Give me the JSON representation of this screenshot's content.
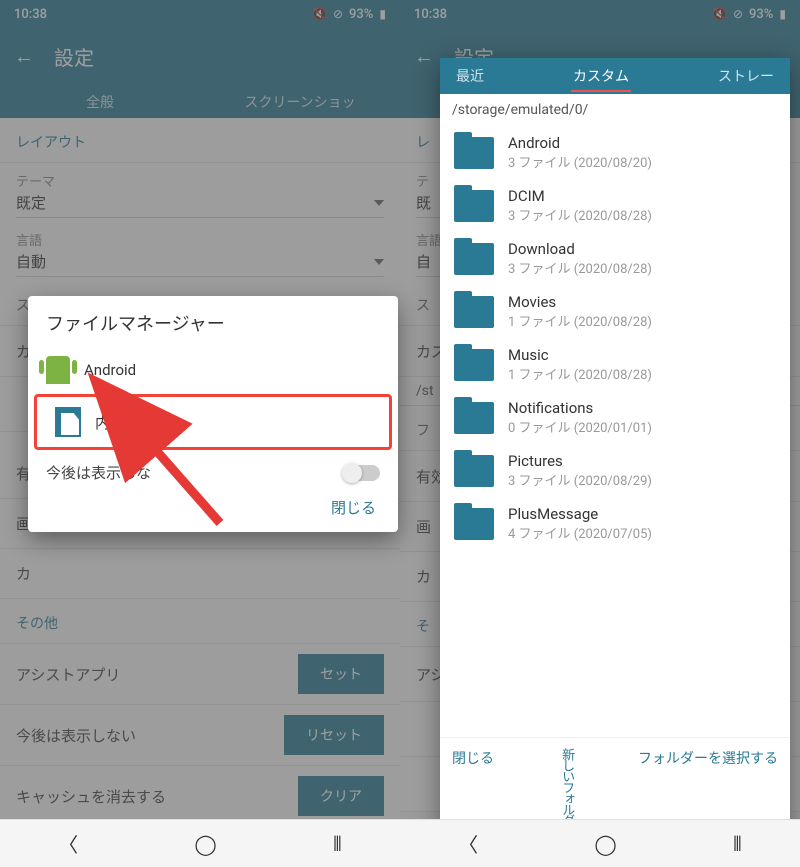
{
  "status": {
    "time": "10:38",
    "battery": "93%"
  },
  "left": {
    "title": "設定",
    "tabs": [
      "全般",
      "スクリーンショッ"
    ],
    "sections": {
      "layout": "レイアウト",
      "theme_label": "テーマ",
      "theme_value": "既定",
      "lang_label": "言語",
      "lang_value": "自動",
      "other": "その他"
    },
    "rows": {
      "assist": "アシストアプリ",
      "assist_btn": "セット",
      "dont_show": "今後は表示しない",
      "dont_show_btn": "リセット",
      "cache": "キャッシュを消去する",
      "cache_btn": "クリア",
      "enabled": "有"
    },
    "dialog": {
      "title": "ファイルマネージャー",
      "item_android": "Android",
      "item_internal": "内部",
      "dont_show": "今後は表示しな",
      "close": "閉じる"
    }
  },
  "right": {
    "title": "設定",
    "tabs": {
      "recent": "最近",
      "custom": "カスタム",
      "store": "ストレー"
    },
    "path": "/storage/emulated/0/",
    "folders": [
      {
        "name": "Android",
        "sub": "3 ファイル (2020/08/20)"
      },
      {
        "name": "DCIM",
        "sub": "3 ファイル (2020/08/28)"
      },
      {
        "name": "Download",
        "sub": "3 ファイル (2020/08/28)"
      },
      {
        "name": "Movies",
        "sub": "1 ファイル (2020/08/28)"
      },
      {
        "name": "Music",
        "sub": "1 ファイル (2020/08/28)"
      },
      {
        "name": "Notifications",
        "sub": "0 ファイル (2020/01/01)"
      },
      {
        "name": "Pictures",
        "sub": "3 ファイル (2020/08/29)"
      },
      {
        "name": "PlusMessage",
        "sub": "4 ファイル (2020/07/05)"
      }
    ],
    "actions": {
      "close": "閉じる",
      "newfolder": "新しいフォルダ",
      "select": "フォルダーを選択する"
    },
    "bg": {
      "layout": "レ",
      "theme_label": "テ",
      "theme_value": "既",
      "lang_label": "言語",
      "lang_value": "自",
      "custom": "カス",
      "path": "/st",
      "enabled": "有効",
      "image": "画",
      "other": "そ",
      "assist": "アシ"
    }
  }
}
